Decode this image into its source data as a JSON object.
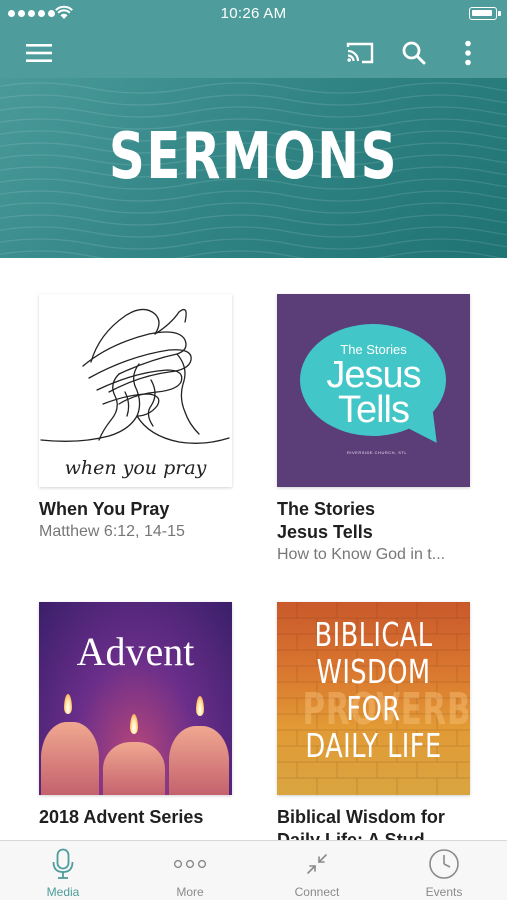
{
  "status_bar": {
    "time": "10:26 AM",
    "icons": [
      "signal-dots-icon",
      "wifi-icon",
      "battery-icon"
    ]
  },
  "app_bar": {
    "icons": [
      "menu-icon",
      "cast-icon",
      "search-icon",
      "more-vert-icon"
    ],
    "color": "#4e9c9c"
  },
  "hero": {
    "title": "SERMONS"
  },
  "series": [
    {
      "title": "When You Pray",
      "subtitle": "Matthew 6:12, 14-15",
      "art_text": "when you pray"
    },
    {
      "title": "The Stories\nJesus Tells",
      "subtitle": "How to Know God in t...",
      "art_small": "The Stories",
      "art_line1": "Jesus",
      "art_line2": "Tells",
      "art_footer": "RIVERSIDE CHURCH, STL"
    },
    {
      "title": "2018 Advent Series",
      "subtitle": "",
      "art_text": "Advent"
    },
    {
      "title": "Biblical Wisdom for\nDaily Life: A Stud",
      "subtitle": "",
      "art_lines": [
        "BIBLICAL",
        "WISDOM",
        "FOR",
        "DAILY LIFE"
      ],
      "art_watermark": "PROVERBS"
    }
  ],
  "tabs": [
    {
      "label": "Media",
      "icon": "microphone-icon",
      "active": true
    },
    {
      "label": "More",
      "icon": "dots-icon",
      "active": false
    },
    {
      "label": "Connect",
      "icon": "compress-arrows-icon",
      "active": false
    },
    {
      "label": "Events",
      "icon": "clock-icon",
      "active": false
    }
  ],
  "colors": {
    "accent": "#4e9c9c",
    "inactive": "#8a8a8a"
  }
}
